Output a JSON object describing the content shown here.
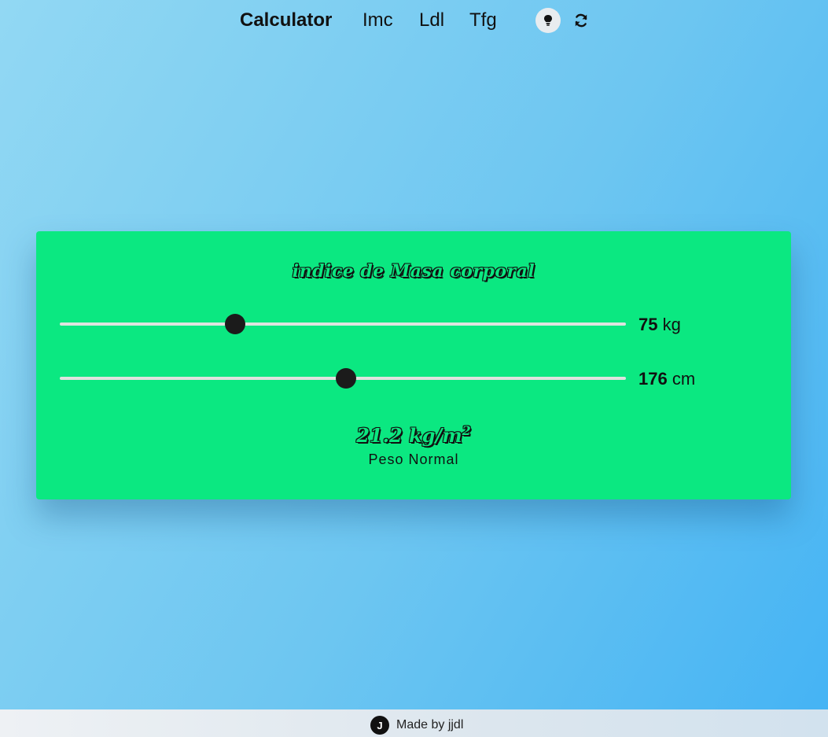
{
  "nav": {
    "brand": "Calculator",
    "links": [
      "Imc",
      "Ldl",
      "Tfg"
    ],
    "theme_button_icon": "lightbulb-icon",
    "refresh_button_icon": "refresh-icon"
  },
  "card": {
    "title": "indice de Masa corporal",
    "weight": {
      "value": "75",
      "unit": "kg",
      "slider_fraction": 0.31
    },
    "height": {
      "value": "176",
      "unit": "cm",
      "slider_fraction": 0.505
    },
    "result": {
      "value": "21.2",
      "unit": "kg/m",
      "exponent": "2"
    },
    "status": "Peso Normal"
  },
  "footer": {
    "logo_letter": "J",
    "text": "Made by jjdl"
  },
  "colors": {
    "card_background": "#0be881",
    "page_gradient_start": "#92d8f3",
    "page_gradient_end": "#44b3f4",
    "slider_thumb": "#1b1b1b"
  }
}
